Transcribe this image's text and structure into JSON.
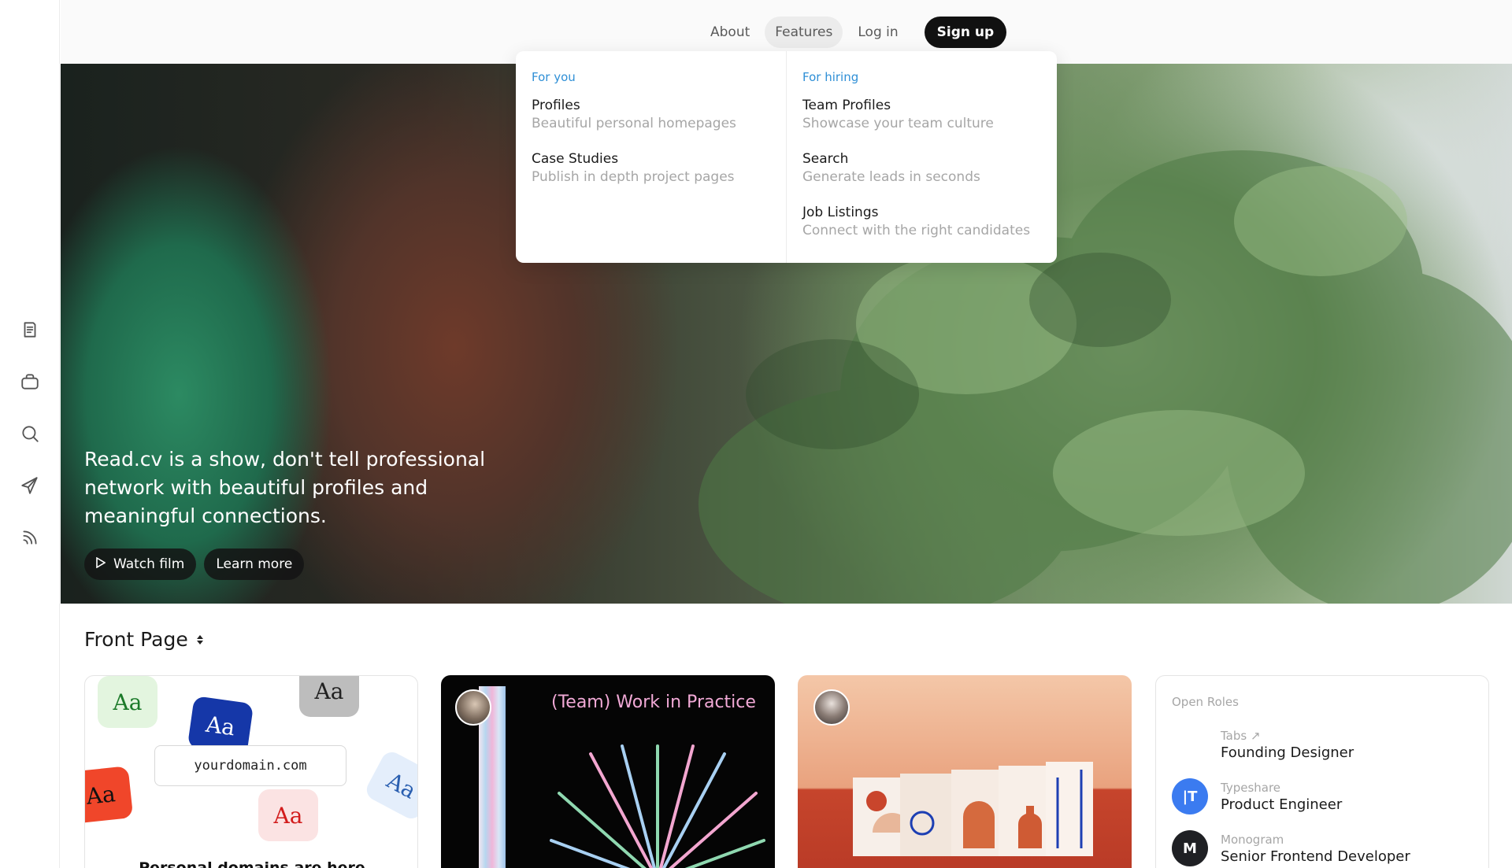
{
  "nav": {
    "about": "About",
    "features": "Features",
    "login": "Log in",
    "signup": "Sign up"
  },
  "dropdown": {
    "for_you": {
      "heading": "For you",
      "items": [
        {
          "title": "Profiles",
          "subtitle": "Beautiful personal homepages"
        },
        {
          "title": "Case Studies",
          "subtitle": "Publish in depth project pages"
        }
      ]
    },
    "for_hiring": {
      "heading": "For hiring",
      "items": [
        {
          "title": "Team Profiles",
          "subtitle": "Showcase your team culture"
        },
        {
          "title": "Search",
          "subtitle": "Generate leads in seconds"
        },
        {
          "title": "Job Listings",
          "subtitle": "Connect with the right candidates"
        }
      ]
    }
  },
  "hero": {
    "tagline": "Read.cv is a show, don't tell professional network with beautiful profiles and meaningful connections.",
    "watch_film": "Watch film",
    "learn_more": "Learn more"
  },
  "rail": {
    "icons": [
      "notes-icon",
      "briefcase-icon",
      "search-icon",
      "send-icon",
      "feed-icon"
    ]
  },
  "front_page": {
    "title": "Front Page",
    "card1": {
      "chips": [
        "Aa",
        "Aa",
        "Aa",
        "Aa",
        "Aa",
        "Aa"
      ],
      "domain": "yourdomain.com",
      "caption": "Personal domains are here"
    },
    "card2": {
      "title": "(Team) Work in Practice"
    },
    "open_roles": {
      "heading": "Open Roles",
      "roles": [
        {
          "company": "Tabs ↗",
          "title": "Founding Designer"
        },
        {
          "company": "Typeshare",
          "title": "Product Engineer",
          "logo": "|T"
        },
        {
          "company": "Monogram",
          "title": "Senior Frontend Developer",
          "logo": "M"
        }
      ]
    }
  },
  "colors": {
    "accent_blue": "#2f8fd6",
    "signup_bg": "#111111",
    "muted_text": "#a6a6a6"
  }
}
